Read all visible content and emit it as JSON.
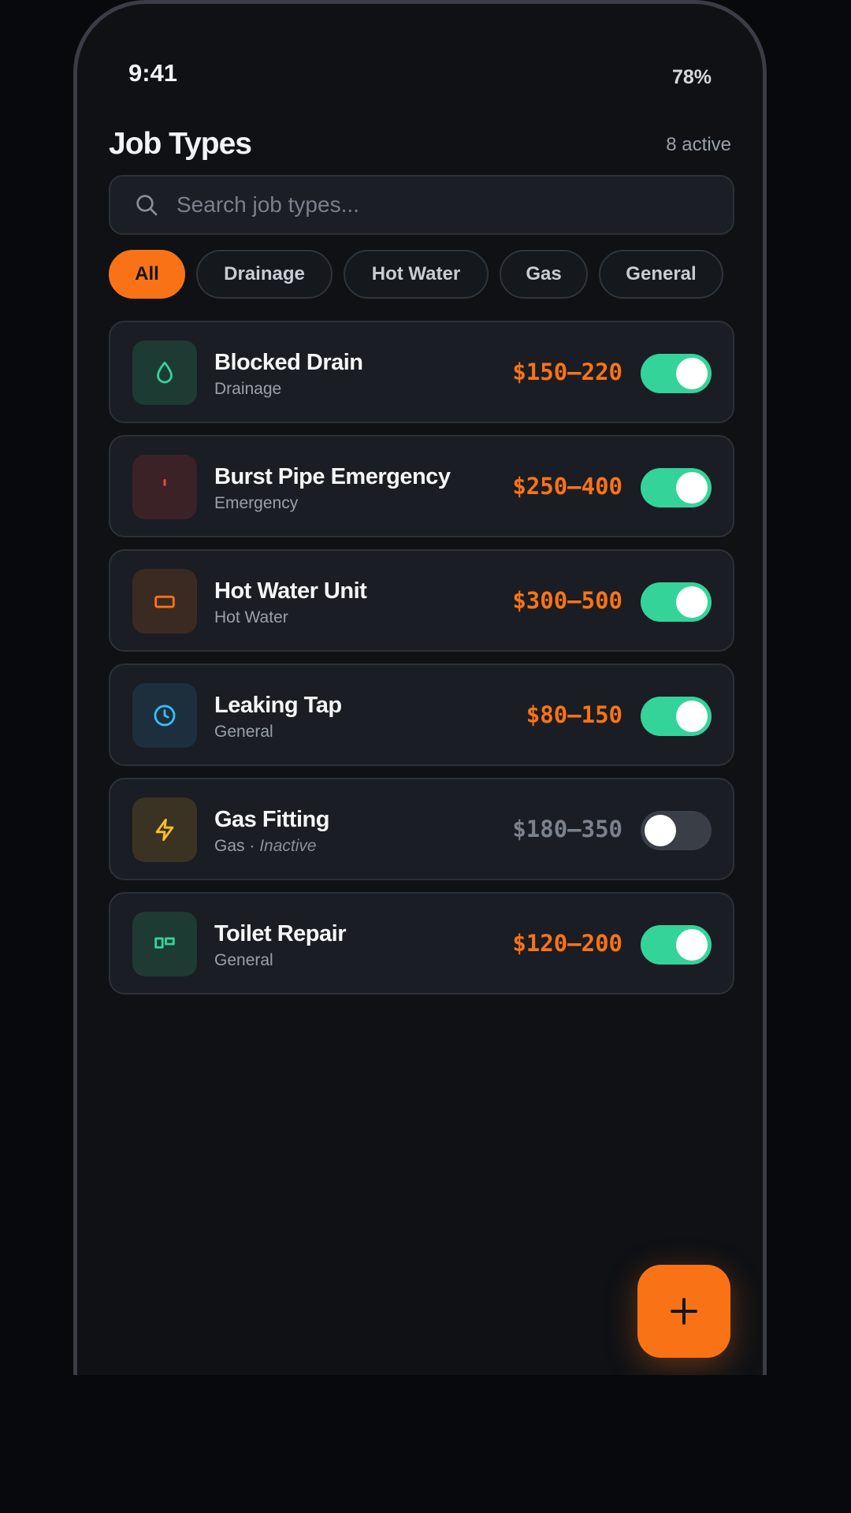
{
  "status_bar": {
    "time": "9:41",
    "battery": "78%"
  },
  "header": {
    "title": "Job Types",
    "active_count": "8 active"
  },
  "search": {
    "placeholder": "Search job types..."
  },
  "filters": [
    {
      "label": "All",
      "active": true
    },
    {
      "label": "Drainage",
      "active": false
    },
    {
      "label": "Hot Water",
      "active": false
    },
    {
      "label": "Gas",
      "active": false
    },
    {
      "label": "General",
      "active": false
    }
  ],
  "jobs": [
    {
      "name": "Blocked Drain",
      "category": "Drainage",
      "price": "$150–220",
      "enabled": true,
      "icon": "droplet-icon",
      "icon_color": "#34d399",
      "tile_color": "#1d3a33"
    },
    {
      "name": "Burst Pipe Emergency",
      "category": "Emergency",
      "price": "$250–400",
      "enabled": true,
      "icon": "alert-icon",
      "icon_color": "#ef4444",
      "tile_color": "#3a2226"
    },
    {
      "name": "Hot Water Unit",
      "category": "Hot Water",
      "price": "$300–500",
      "enabled": true,
      "icon": "water-heater-icon",
      "icon_color": "#f97316",
      "tile_color": "#3a2a22"
    },
    {
      "name": "Leaking Tap",
      "category": "General",
      "price": "$80–150",
      "enabled": true,
      "icon": "clock-icon",
      "icon_color": "#38bdf8",
      "tile_color": "#1d2f3d"
    },
    {
      "name": "Gas Fitting",
      "category": "Gas",
      "status_note": "Inactive",
      "price": "$180–350",
      "enabled": false,
      "icon": "bolt-icon",
      "icon_color": "#fbbf24",
      "tile_color": "#3a3222"
    },
    {
      "name": "Toilet Repair",
      "category": "General",
      "price": "$120–200",
      "enabled": true,
      "icon": "toilet-icon",
      "icon_color": "#34d399",
      "tile_color": "#1d3a33"
    }
  ],
  "fab": {
    "icon": "plus-icon",
    "color": "#f97316"
  },
  "colors": {
    "accent": "#f97316",
    "toggle_on": "#34d399",
    "toggle_off": "#3a3e47"
  }
}
